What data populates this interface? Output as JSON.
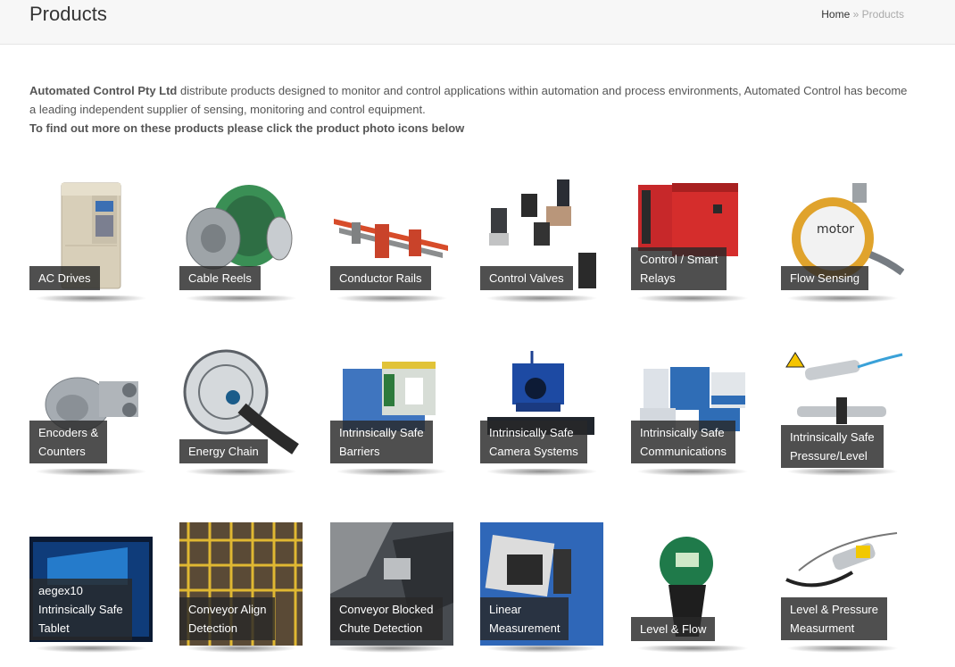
{
  "header": {
    "title": "Products",
    "breadcrumb": {
      "home": "Home",
      "separator": "»",
      "current": "Products"
    }
  },
  "intro": {
    "company": "Automated Control Pty Ltd",
    "text": " distribute products designed to monitor and control applications within automation and process environments, Automated Control has become a leading independent supplier of sensing, monitoring and control equipment.",
    "cta": "To find out more on these products please click the product photo icons below"
  },
  "products": [
    {
      "label": "AC Drives",
      "icon": "ac-drive-icon"
    },
    {
      "label": "Cable Reels",
      "icon": "cable-reel-icon"
    },
    {
      "label": "Conductor Rails",
      "icon": "conductor-rail-icon"
    },
    {
      "label": "Control Valves",
      "icon": "valve-icon"
    },
    {
      "label": "Control / Smart\nRelays",
      "icon": "relay-icon"
    },
    {
      "label": "Flow Sensing",
      "icon": "flow-sensor-icon"
    },
    {
      "label": "Encoders &\nCounters",
      "icon": "encoder-icon"
    },
    {
      "label": "Energy Chain",
      "icon": "energy-chain-icon"
    },
    {
      "label": "Intrinsically Safe\nBarriers",
      "icon": "barrier-icon"
    },
    {
      "label": "Intrinsically Safe\nCamera Systems",
      "icon": "camera-icon"
    },
    {
      "label": "Intrinsically Safe\nCommunications",
      "icon": "communications-icon"
    },
    {
      "label": "Intrinsically Safe\nPressure/Level",
      "icon": "pressure-sensor-icon"
    },
    {
      "label": "aegex10\nIntrinsically Safe\nTablet",
      "icon": "tablet-icon"
    },
    {
      "label": "Conveyor Align\nDetection",
      "icon": "conveyor-align-icon"
    },
    {
      "label": "Conveyor Blocked\nChute Detection",
      "icon": "chute-icon"
    },
    {
      "label": "Linear\nMeasurement",
      "icon": "linear-sensor-icon"
    },
    {
      "label": "Level & Flow",
      "icon": "level-sensor-icon"
    },
    {
      "label": "Level & Pressure\nMeasurment",
      "icon": "pressure-gauge-icon"
    }
  ]
}
